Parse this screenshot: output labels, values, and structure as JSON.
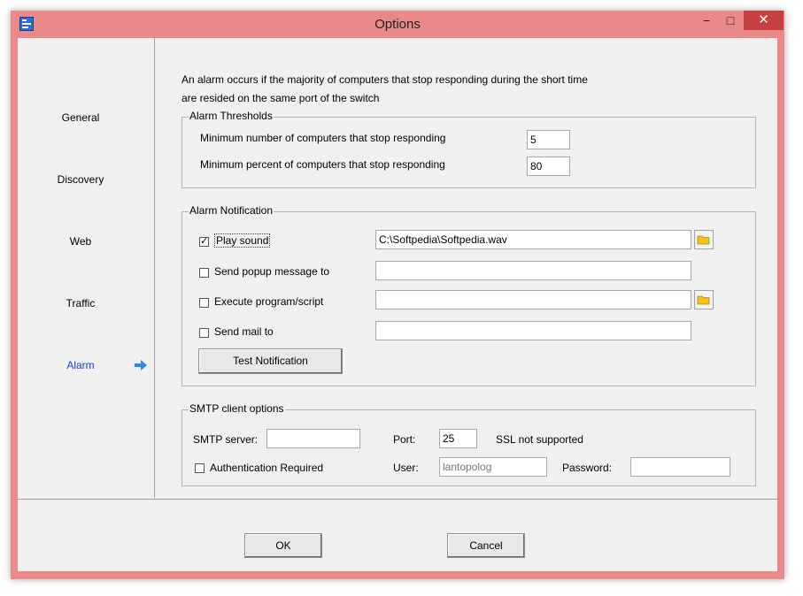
{
  "window": {
    "title": "Options",
    "controls": {
      "minimize": "−",
      "maximize": "□",
      "close": "✕"
    }
  },
  "sidebar": {
    "items": [
      {
        "label": "General"
      },
      {
        "label": "Discovery"
      },
      {
        "label": "Web"
      },
      {
        "label": "Traffic"
      },
      {
        "label": "Alarm"
      }
    ],
    "active": "Alarm",
    "active_arrow_icon": "arrow-right-icon",
    "active_color": "#1a3bd8",
    "arrow_color": "#2b8ce8"
  },
  "intro": {
    "line1": "An alarm occurs if the majority of computers that stop responding  during the short time",
    "line2": "are resided on the same port of the switch"
  },
  "thresholds": {
    "legend": "Alarm Thresholds",
    "min_count_label": "Minimum number of computers that stop responding",
    "min_count_value": "5",
    "min_percent_label": "Minimum percent of computers that stop responding",
    "min_percent_value": "80"
  },
  "notification": {
    "legend": "Alarm Notification",
    "play_sound": {
      "label": "Play sound",
      "checked": true,
      "value": "C:\\Softpedia\\Softpedia.wav"
    },
    "popup": {
      "label": "Send popup message to",
      "checked": false,
      "value": ""
    },
    "execute": {
      "label": "Execute program/script",
      "checked": false,
      "value": ""
    },
    "mail": {
      "label": "Send mail to",
      "checked": false,
      "value": ""
    },
    "test_button": "Test Notification",
    "folder_icon": "folder-icon"
  },
  "smtp": {
    "legend": "SMTP client options",
    "server_label": "SMTP server:",
    "server_value": "",
    "port_label": "Port:",
    "port_value": "25",
    "ssl_text": "SSL not supported",
    "auth_label": "Authentication Required",
    "auth_checked": false,
    "user_label": "User:",
    "user_value": "lantopolog",
    "password_label": "Password:",
    "password_value": ""
  },
  "footer": {
    "ok": "OK",
    "cancel": "Cancel"
  },
  "colors": {
    "frame": "#e9898a",
    "close_button": "#c7403f",
    "client_bg": "#f0f0f0"
  }
}
